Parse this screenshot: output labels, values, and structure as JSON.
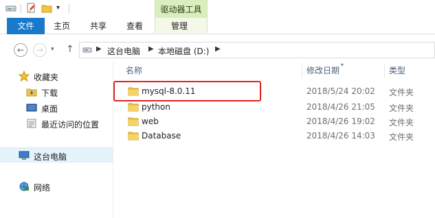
{
  "context_tab": {
    "label": "驱动器工具"
  },
  "ribbon": {
    "file_tab": "文件",
    "tabs": [
      "主页",
      "共享",
      "查看"
    ],
    "context_sub_tab": "管理"
  },
  "address": {
    "crumbs": [
      "这台电脑",
      "本地磁盘 (D:)"
    ]
  },
  "navpane": {
    "favorites": "收藏夹",
    "favorites_items": [
      "下载",
      "桌面",
      "最近访问的位置"
    ],
    "this_pc": "这台电脑",
    "network": "网络"
  },
  "columns": {
    "name": "名称",
    "date": "修改日期",
    "type": "类型"
  },
  "files": [
    {
      "name": "mysql-8.0.11",
      "date": "2018/5/24 20:02",
      "type": "文件夹"
    },
    {
      "name": "python",
      "date": "2018/4/26 21:05",
      "type": "文件夹"
    },
    {
      "name": "web",
      "date": "2018/4/26 19:02",
      "type": "文件夹"
    },
    {
      "name": "Database",
      "date": "2018/4/26 14:03",
      "type": "文件夹"
    }
  ],
  "colors": {
    "file_tab": "#1979ca",
    "context_tab": "#d9eebd",
    "highlight": "#e0201b",
    "folder": "#f4c542"
  }
}
